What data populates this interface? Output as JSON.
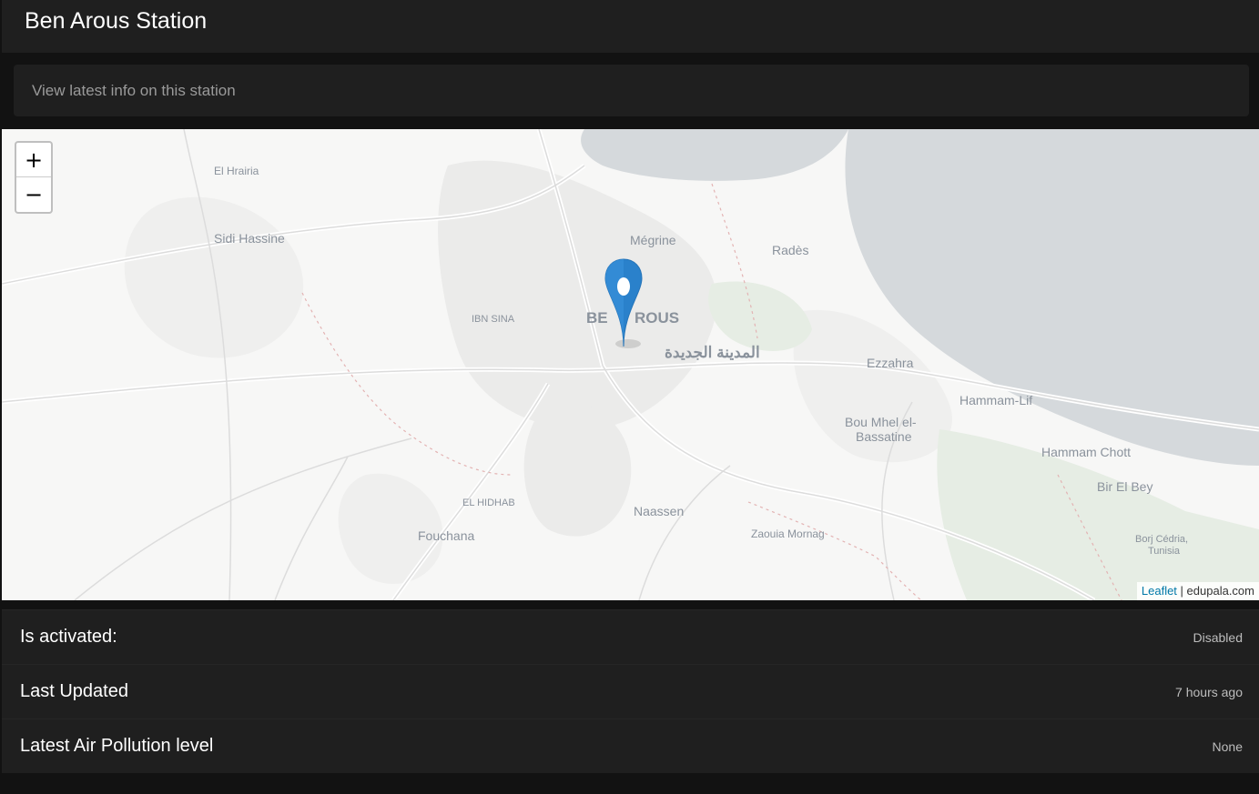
{
  "header": {
    "title": "Ben Arous Station"
  },
  "subheader": {
    "text": "View latest info on this station"
  },
  "map": {
    "zoom_in": "+",
    "zoom_out": "−",
    "attribution_link": "Leaflet",
    "attribution_sep": " | ",
    "attribution_source": "edupala.com",
    "marker_icon": "map-pin-icon",
    "marker_color": "#2a81cb",
    "places": {
      "el_hrairia": "El Hrairia",
      "sidi_hassine": "Sidi Hassine",
      "megrine": "Mégrine",
      "rades": "Radès",
      "ibn_sina": "IBN SINA",
      "ben_arous_a": "BE",
      "ben_arous_b": "ROUS",
      "medina_jadida": "المدينة الجديدة",
      "ezzahra": "Ezzahra",
      "hammam_lif": "Hammam-Lif",
      "bou_mhel_1": "Bou Mhel el-",
      "bou_mhel_2": "Bassatine",
      "hammam_chott": "Hammam Chott",
      "bir_el_bey": "Bir El Bey",
      "el_hidhab": "EL HIDHAB",
      "naassen": "Naassen",
      "fouchana": "Fouchana",
      "zaouia_mornag": "Zaouia Mornag",
      "borj_cedria_1": "Borj Cédria,",
      "borj_cedria_2": "Tunisia"
    }
  },
  "details": [
    {
      "label": "Is activated:",
      "value": "Disabled"
    },
    {
      "label": "Last Updated",
      "value": "7 hours ago"
    },
    {
      "label": "Latest Air Pollution level",
      "value": "None"
    }
  ]
}
